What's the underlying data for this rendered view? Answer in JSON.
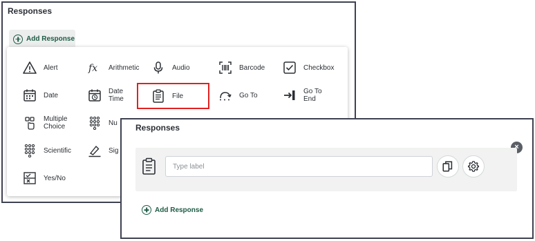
{
  "back_panel": {
    "title": "Responses",
    "add_response_label": "Add Response"
  },
  "menu": {
    "items": [
      {
        "label": "Alert",
        "icon": "alert-triangle-icon"
      },
      {
        "label": "Arithmetic",
        "icon": "function-fx-icon"
      },
      {
        "label": "Audio",
        "icon": "microphone-icon"
      },
      {
        "label": "Barcode",
        "icon": "barcode-icon"
      },
      {
        "label": "Checkbox",
        "icon": "checkbox-icon"
      },
      {
        "label": "Date",
        "icon": "calendar-icon"
      },
      {
        "label": "Date\nTime",
        "icon": "calendar-clock-icon"
      },
      {
        "label": "File",
        "icon": "file-clipboard-icon"
      },
      {
        "label": "Go To",
        "icon": "go-to-arrow-icon"
      },
      {
        "label": "Go To\nEnd",
        "icon": "go-to-end-icon"
      },
      {
        "label": "Multiple\nChoice",
        "icon": "multiple-choice-icon"
      },
      {
        "label": "Nu",
        "icon": "number-grid-icon"
      },
      {
        "label": "Scientific",
        "icon": "scientific-keypad-icon"
      },
      {
        "label": "Sig",
        "icon": "signature-icon"
      },
      {
        "label": "Yes/No",
        "icon": "yes-no-icon"
      }
    ],
    "highlighted": "File"
  },
  "front_panel": {
    "title": "Responses",
    "close_glyph": "×",
    "response_row": {
      "icon": "file-clipboard-icon",
      "label_placeholder": "Type label",
      "label_value": ""
    },
    "actions": {
      "duplicate_icon": "copy-icon",
      "settings_icon": "gear-icon"
    },
    "add_response_label": "Add Response"
  },
  "colors": {
    "accent_green": "#1d5b44",
    "highlight_red": "#e02020",
    "frame": "#3d4150"
  }
}
